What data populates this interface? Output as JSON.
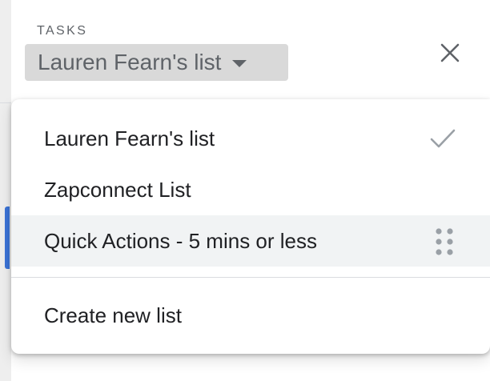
{
  "header": {
    "section_label": "TASKS",
    "current_list": "Lauren Fearn's list"
  },
  "menu": {
    "items": [
      {
        "label": "Lauren Fearn's list",
        "selected": true,
        "icon": "check-icon"
      },
      {
        "label": "Zapconnect List"
      },
      {
        "label": "Quick Actions - 5 mins or less",
        "hovered": true,
        "icon": "drag-handle-icon"
      }
    ],
    "create_label": "Create new list"
  },
  "colors": {
    "accent": "#3b73d6",
    "selector_bg": "#d9d9d9",
    "hover_bg": "#f1f3f4",
    "text": "#202124",
    "muted": "#5f6368"
  }
}
